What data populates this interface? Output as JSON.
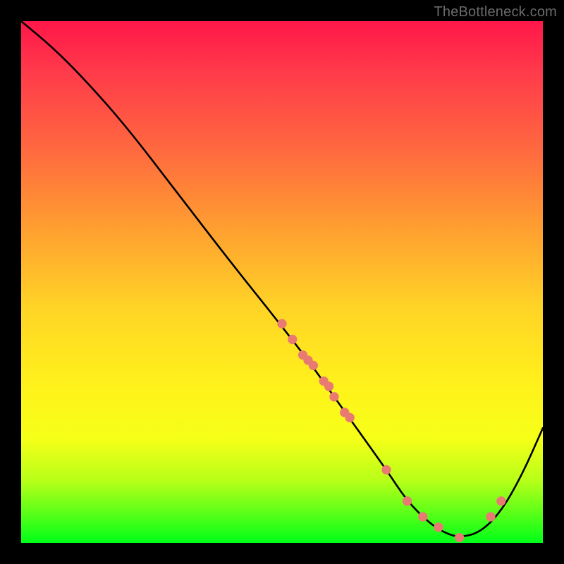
{
  "watermark": "TheBottleneck.com",
  "chart_data": {
    "type": "line",
    "title": "",
    "xlabel": "",
    "ylabel": "",
    "xlim": [
      0,
      100
    ],
    "ylim": [
      0,
      100
    ],
    "curve": {
      "x": [
        0,
        6,
        12,
        20,
        30,
        40,
        48,
        55,
        60,
        65,
        70,
        74,
        78,
        81,
        84,
        88,
        92,
        96,
        100
      ],
      "y": [
        100,
        95,
        89,
        80,
        67,
        54,
        44,
        35,
        28,
        21,
        14,
        8,
        4,
        2,
        1,
        2,
        6,
        13,
        22
      ]
    },
    "scatter_points": {
      "x": [
        50,
        52,
        54,
        55,
        56,
        58,
        59,
        60,
        62,
        63,
        70,
        74,
        77,
        80,
        84,
        90,
        92
      ],
      "y": [
        42,
        39,
        36,
        35,
        34,
        31,
        30,
        28,
        25,
        24,
        14,
        8,
        5,
        3,
        1,
        5,
        8
      ]
    },
    "colors": {
      "curve": "#000000",
      "points": "#e87a72"
    }
  }
}
